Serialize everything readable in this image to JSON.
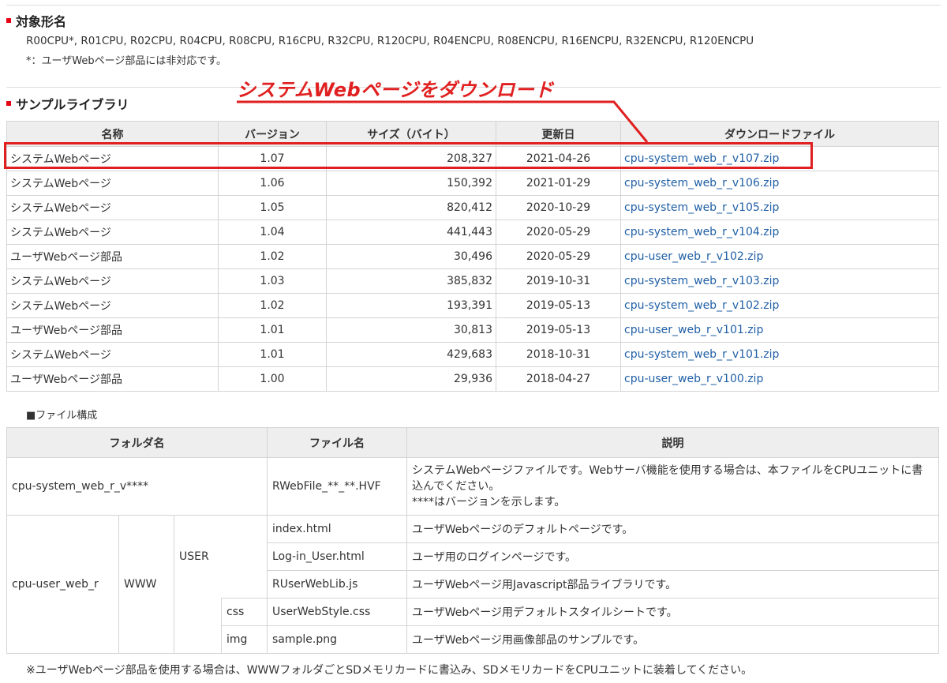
{
  "target": {
    "heading": "対象形名",
    "models": "R00CPU*, R01CPU, R02CPU, R04CPU, R08CPU, R16CPU, R32CPU, R120CPU, R04ENCPU, R08ENCPU, R16ENCPU, R32ENCPU, R120ENCPU",
    "note": "*：ユーザWebページ部品には非対応です。"
  },
  "library": {
    "heading": "サンプルライブラリ",
    "callout": "システムWebページをダウンロード",
    "headers": [
      "名称",
      "バージョン",
      "サイズ（バイト）",
      "更新日",
      "ダウンロードファイル"
    ],
    "rows": [
      {
        "name": "システムWebページ",
        "version": "1.07",
        "size": "208,327",
        "date": "2021-04-26",
        "file": "cpu-system_web_r_v107.zip"
      },
      {
        "name": "システムWebページ",
        "version": "1.06",
        "size": "150,392",
        "date": "2021-01-29",
        "file": "cpu-system_web_r_v106.zip"
      },
      {
        "name": "システムWebページ",
        "version": "1.05",
        "size": "820,412",
        "date": "2020-10-29",
        "file": "cpu-system_web_r_v105.zip"
      },
      {
        "name": "システムWebページ",
        "version": "1.04",
        "size": "441,443",
        "date": "2020-05-29",
        "file": "cpu-system_web_r_v104.zip"
      },
      {
        "name": "ユーザWebページ部品",
        "version": "1.02",
        "size": "30,496",
        "date": "2020-05-29",
        "file": "cpu-user_web_r_v102.zip"
      },
      {
        "name": "システムWebページ",
        "version": "1.03",
        "size": "385,832",
        "date": "2019-10-31",
        "file": "cpu-system_web_r_v103.zip"
      },
      {
        "name": "システムWebページ",
        "version": "1.02",
        "size": "193,391",
        "date": "2019-05-13",
        "file": "cpu-system_web_r_v102.zip"
      },
      {
        "name": "ユーザWebページ部品",
        "version": "1.01",
        "size": "30,813",
        "date": "2019-05-13",
        "file": "cpu-user_web_r_v101.zip"
      },
      {
        "name": "システムWebページ",
        "version": "1.01",
        "size": "429,683",
        "date": "2018-10-31",
        "file": "cpu-system_web_r_v101.zip"
      },
      {
        "name": "ユーザWebページ部品",
        "version": "1.00",
        "size": "29,936",
        "date": "2018-04-27",
        "file": "cpu-user_web_r_v100.zip"
      }
    ]
  },
  "file_structure": {
    "label": "■ファイル構成",
    "headers": [
      "フォルダ名",
      "ファイル名",
      "説明"
    ],
    "system_folder": "cpu-system_web_r_v****",
    "system_file": "RWebFile_**_**.HVF",
    "system_desc_1": "システムWebページファイルです。Webサーバ機能を使用する場合は、本ファイルをCPUユニットに書込んでください。",
    "system_desc_2": "****はバージョンを示します。",
    "user_folder": "cpu-user_web_r",
    "www": "WWW",
    "user": "USER",
    "css": "css",
    "img": "img",
    "files": [
      {
        "file": "index.html",
        "desc": "ユーザWebページのデフォルトページです。"
      },
      {
        "file": "Log-in_User.html",
        "desc": "ユーザ用のログインページです。"
      },
      {
        "file": "RUserWebLib.js",
        "desc": "ユーザWebページ用Javascript部品ライブラリです。"
      },
      {
        "file": "UserWebStyle.css",
        "desc": "ユーザWebページ用デフォルトスタイルシートです。"
      },
      {
        "file": "sample.png",
        "desc": "ユーザWebページ用画像部品のサンプルです。"
      }
    ],
    "footnote": "※ユーザWebページ部品を使用する場合は、WWWフォルダごとSDメモリカードに書込み、SDメモリカードをCPUユニットに装着してください。"
  },
  "colors": {
    "accent": "#e60012",
    "annotation": "#e02020",
    "link": "#1f5fa6"
  }
}
